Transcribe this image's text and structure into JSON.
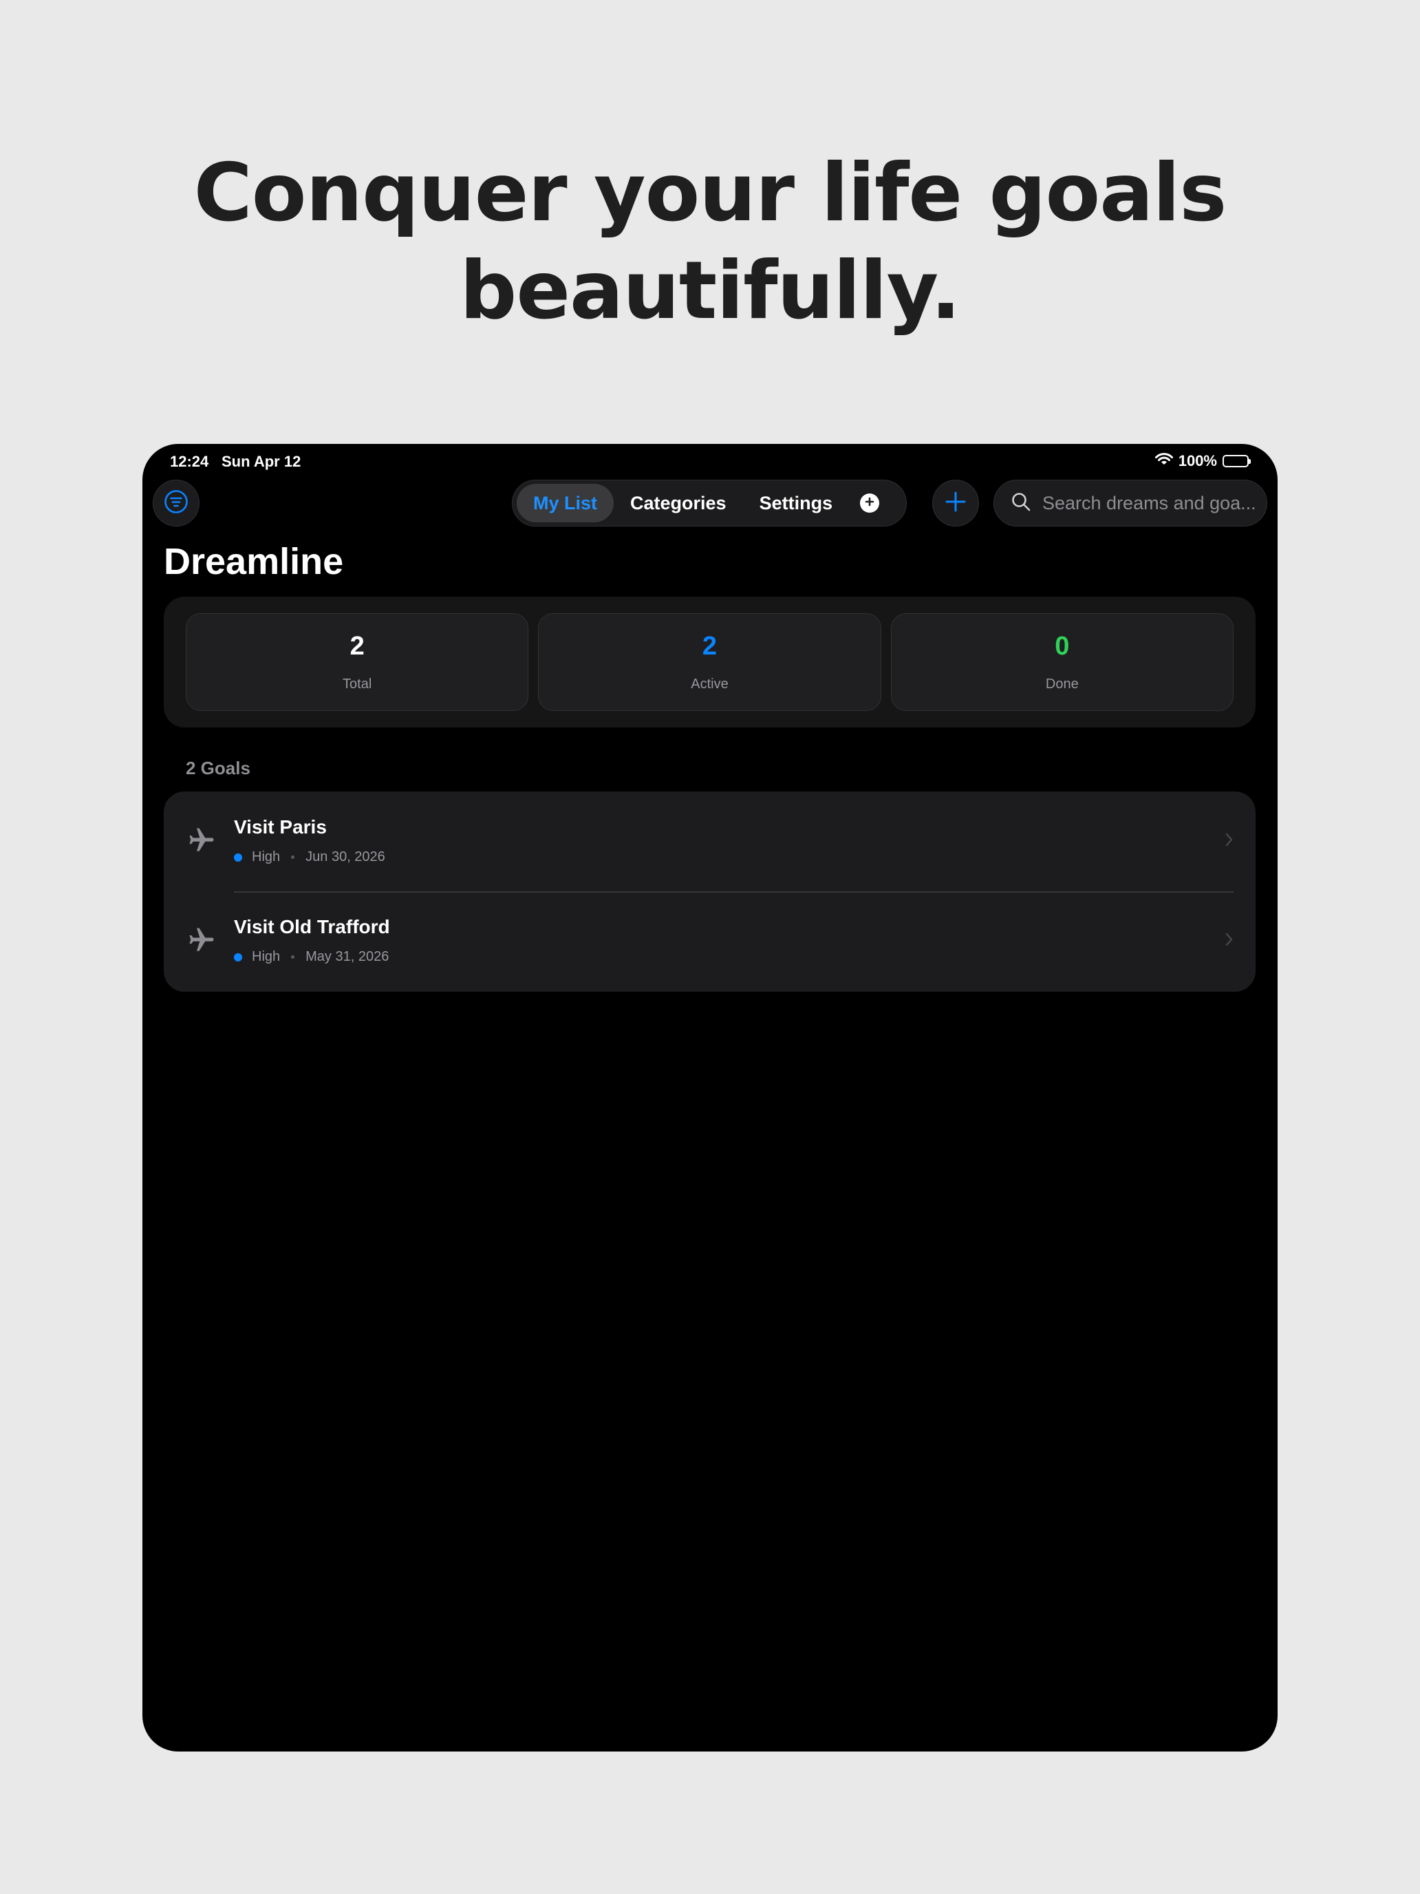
{
  "headline": {
    "line1": "Conquer your life goals",
    "line2": "beautifully."
  },
  "status_bar": {
    "time": "12:24",
    "date": "Sun Apr 12",
    "battery": "100%"
  },
  "toolbar": {
    "tabs": [
      {
        "label": "My List",
        "active": true
      },
      {
        "label": "Categories",
        "active": false
      },
      {
        "label": "Settings",
        "active": false
      }
    ],
    "search_placeholder": "Search dreams and goa..."
  },
  "page": {
    "title": "Dreamline"
  },
  "stats": [
    {
      "value": "2",
      "label": "Total",
      "color": "#ffffff"
    },
    {
      "value": "2",
      "label": "Active",
      "color": "#0a84ff"
    },
    {
      "value": "0",
      "label": "Done",
      "color": "#30d158"
    }
  ],
  "goals": {
    "count_label": "2 Goals",
    "items": [
      {
        "title": "Visit Paris",
        "priority": "High",
        "date": "Jun 30, 2026",
        "icon": "airplane-icon"
      },
      {
        "title": "Visit Old Trafford",
        "priority": "High",
        "date": "May 31, 2026",
        "icon": "airplane-icon"
      }
    ]
  },
  "colors": {
    "accent": "#0a84ff",
    "done": "#30d158",
    "background": "#000000",
    "card": "#1c1c1e"
  }
}
